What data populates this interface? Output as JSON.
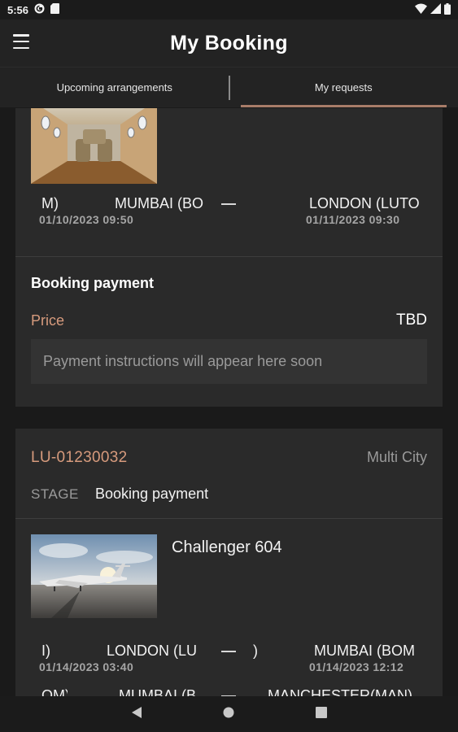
{
  "status_bar": {
    "time": "5:56"
  },
  "header": {
    "title": "My Booking"
  },
  "tabs": [
    {
      "label": "Upcoming arrangements"
    },
    {
      "label": "My requests"
    }
  ],
  "booking1": {
    "route": {
      "from_tail": "M)",
      "from_city": "MUMBAI (BO",
      "from_date": "01/10/2023  09:50",
      "to_city": "LONDON (LUTO",
      "to_date": "01/11/2023  09:30"
    },
    "payment": {
      "title": "Booking payment",
      "price_label": "Price",
      "price_value": "TBD",
      "instructions": "Payment instructions will appear here soon"
    }
  },
  "booking2": {
    "ref": "LU-01230032",
    "trip_type": "Multi City",
    "stage_label": "STAGE",
    "stage_value": "Booking payment",
    "aircraft": "Challenger 604",
    "leg1": {
      "from_tail": "I)",
      "from_city": "LONDON (LU",
      "from_date": "01/14/2023  03:40",
      "mid_tail": ")",
      "to_city": "MUMBAI (BOM",
      "to_date": "01/14/2023  12:12"
    },
    "leg2": {
      "from_tail": "OM)",
      "from_city": "MUMBAI (B",
      "to_city": "MANCHESTER(MAN)"
    }
  },
  "colors": {
    "accent": "#d79b7d",
    "tab_indicator": "#a87c68",
    "card_bg": "#2a2a2a",
    "page_bg": "#1a1a1a"
  }
}
